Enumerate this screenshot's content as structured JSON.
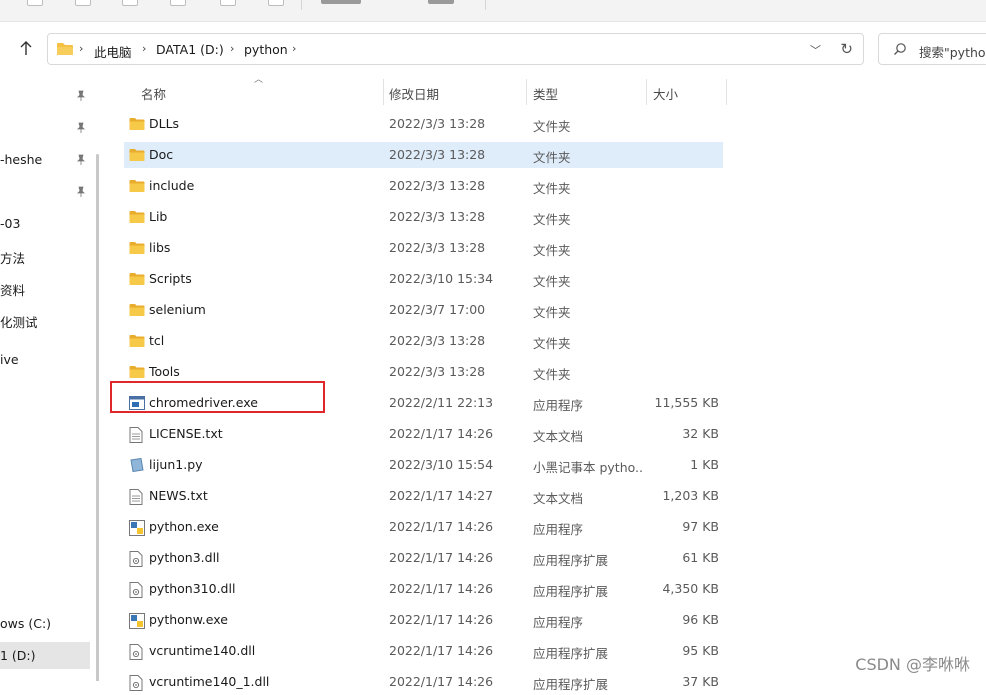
{
  "address": {
    "breadcrumbs": [
      "此电脑",
      "DATA1 (D:)",
      "python"
    ],
    "dropdown_icon": "chevron-down-icon",
    "refresh_icon": "refresh-icon"
  },
  "search": {
    "placeholder": "搜索\"python"
  },
  "nav": {
    "items": [
      "-heshe",
      "-03",
      "方法",
      "资料",
      "化测试",
      "ive",
      "ows (C:)",
      "1 (D:)"
    ],
    "selected": "1 (D:)"
  },
  "columns": {
    "name": "名称",
    "date": "修改日期",
    "type": "类型",
    "size": "大小"
  },
  "files": [
    {
      "name": "DLLs",
      "date": "2022/3/3 13:28",
      "type": "文件夹",
      "size": "",
      "icon": "folder-icon"
    },
    {
      "name": "Doc",
      "date": "2022/3/3 13:28",
      "type": "文件夹",
      "size": "",
      "icon": "folder-icon"
    },
    {
      "name": "include",
      "date": "2022/3/3 13:28",
      "type": "文件夹",
      "size": "",
      "icon": "folder-icon"
    },
    {
      "name": "Lib",
      "date": "2022/3/3 13:28",
      "type": "文件夹",
      "size": "",
      "icon": "folder-icon"
    },
    {
      "name": "libs",
      "date": "2022/3/3 13:28",
      "type": "文件夹",
      "size": "",
      "icon": "folder-icon"
    },
    {
      "name": "Scripts",
      "date": "2022/3/10 15:34",
      "type": "文件夹",
      "size": "",
      "icon": "folder-icon"
    },
    {
      "name": "selenium",
      "date": "2022/3/7 17:00",
      "type": "文件夹",
      "size": "",
      "icon": "folder-icon"
    },
    {
      "name": "tcl",
      "date": "2022/3/3 13:28",
      "type": "文件夹",
      "size": "",
      "icon": "folder-icon"
    },
    {
      "name": "Tools",
      "date": "2022/3/3 13:28",
      "type": "文件夹",
      "size": "",
      "icon": "folder-icon"
    },
    {
      "name": "chromedriver.exe",
      "date": "2022/2/11 22:13",
      "type": "应用程序",
      "size": "11,555 KB",
      "icon": "exe-icon"
    },
    {
      "name": "LICENSE.txt",
      "date": "2022/1/17 14:26",
      "type": "文本文档",
      "size": "32 KB",
      "icon": "text-file-icon"
    },
    {
      "name": "lijun1.py",
      "date": "2022/3/10 15:54",
      "type": "小黑记事本 pytho...",
      "size": "1 KB",
      "icon": "py-file-icon"
    },
    {
      "name": "NEWS.txt",
      "date": "2022/1/17 14:27",
      "type": "文本文档",
      "size": "1,203 KB",
      "icon": "text-file-icon"
    },
    {
      "name": "python.exe",
      "date": "2022/1/17 14:26",
      "type": "应用程序",
      "size": "97 KB",
      "icon": "python-exe-icon"
    },
    {
      "name": "python3.dll",
      "date": "2022/1/17 14:26",
      "type": "应用程序扩展",
      "size": "61 KB",
      "icon": "dll-icon"
    },
    {
      "name": "python310.dll",
      "date": "2022/1/17 14:26",
      "type": "应用程序扩展",
      "size": "4,350 KB",
      "icon": "dll-icon"
    },
    {
      "name": "pythonw.exe",
      "date": "2022/1/17 14:26",
      "type": "应用程序",
      "size": "96 KB",
      "icon": "python-exe-icon"
    },
    {
      "name": "vcruntime140.dll",
      "date": "2022/1/17 14:26",
      "type": "应用程序扩展",
      "size": "95 KB",
      "icon": "dll-icon"
    },
    {
      "name": "vcruntime140_1.dll",
      "date": "2022/1/17 14:26",
      "type": "应用程序扩展",
      "size": "37 KB",
      "icon": "dll-icon"
    }
  ],
  "selected_row": "Doc",
  "highlighted_row": "chromedriver.exe",
  "colors": {
    "folder": "#f4c144",
    "selected_row": "#dfecfa",
    "highlight_box": "#e0272b"
  },
  "watermark": "CSDN @李咻咻"
}
